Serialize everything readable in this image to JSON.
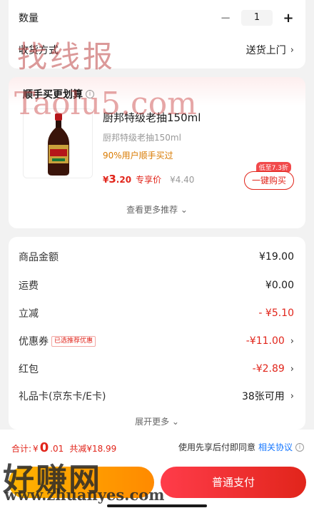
{
  "top": {
    "quantity_label": "数量",
    "quantity_minus": "−",
    "quantity_value": "1",
    "quantity_plus": "+",
    "delivery_label": "收货方式",
    "delivery_value": "送货上门",
    "chevron": "›"
  },
  "recommend": {
    "title": "顺手买更划算",
    "product_name": "厨邦特级老抽150ml",
    "product_sub": "厨邦特级老抽150ml",
    "hot_text": "90%用户顺手买过",
    "price_symbol": "¥",
    "price_int": "3",
    "price_dec": ".20",
    "price_tag": "专享价",
    "original_price": "¥4.40",
    "badge": "低至7.3折",
    "buy_label": "一键购买",
    "more_label": "查看更多推荐 ⌄"
  },
  "price_detail": {
    "rows": [
      {
        "label": "商品金额",
        "value": "¥19.00"
      },
      {
        "label": "运费",
        "value": "¥0.00"
      },
      {
        "label": "立减",
        "value": "- ¥5.10"
      },
      {
        "label": "优惠券",
        "badge": "已选推荐优惠",
        "value": "-¥11.00"
      },
      {
        "label": "红包",
        "value": "-¥2.89"
      },
      {
        "label": "礼品卡(京东卡/E卡)",
        "value": "38张可用"
      }
    ],
    "expand_label": "展开更多 ⌄"
  },
  "bottom": {
    "total_label": "合计:",
    "total_symbol": "¥",
    "total_int": "0",
    "total_dec": ".01",
    "discount": "共减¥18.99",
    "agree_text": "使用先享后付即同意",
    "agree_link": "相关协议",
    "pay_label": "普通支付"
  },
  "watermarks": {
    "wm1": "找线报",
    "wm2": "Taolu5.com",
    "wm3": "好赚网",
    "wm4": "www.zhuanyes.com"
  },
  "colors": {
    "accent": "#e1251b",
    "link": "#1677ff",
    "hot": "#d97a00"
  }
}
